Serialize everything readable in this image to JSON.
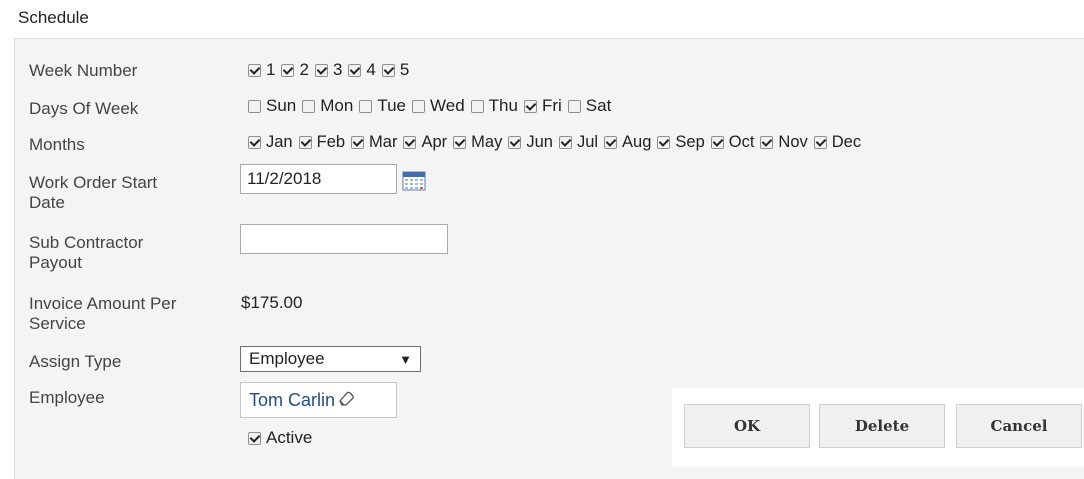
{
  "section_title": "Schedule",
  "labels": {
    "week_number": "Week Number",
    "days_of_week": "Days Of Week",
    "months": "Months",
    "work_order_start_date_1": "Work Order Start",
    "work_order_start_date_2": "Date",
    "sub_contractor_payout_1": "Sub Contractor",
    "sub_contractor_payout_2": "Payout",
    "invoice_amount_1": "Invoice Amount Per",
    "invoice_amount_2": "Service",
    "assign_type": "Assign Type",
    "employee": "Employee"
  },
  "week_numbers": [
    {
      "label": "1",
      "checked": true
    },
    {
      "label": "2",
      "checked": true
    },
    {
      "label": "3",
      "checked": true
    },
    {
      "label": "4",
      "checked": true
    },
    {
      "label": "5",
      "checked": true
    }
  ],
  "days": [
    {
      "label": "Sun",
      "checked": false
    },
    {
      "label": "Mon",
      "checked": false
    },
    {
      "label": "Tue",
      "checked": false
    },
    {
      "label": "Wed",
      "checked": false
    },
    {
      "label": "Thu",
      "checked": false
    },
    {
      "label": "Fri",
      "checked": true
    },
    {
      "label": "Sat",
      "checked": false
    }
  ],
  "months": [
    {
      "label": "Jan",
      "checked": true
    },
    {
      "label": "Feb",
      "checked": true
    },
    {
      "label": "Mar",
      "checked": true
    },
    {
      "label": "Apr",
      "checked": true
    },
    {
      "label": "May",
      "checked": true
    },
    {
      "label": "Jun",
      "checked": true
    },
    {
      "label": "Jul",
      "checked": true
    },
    {
      "label": "Aug",
      "checked": true
    },
    {
      "label": "Sep",
      "checked": true
    },
    {
      "label": "Oct",
      "checked": true
    },
    {
      "label": "Nov",
      "checked": true
    },
    {
      "label": "Dec",
      "checked": true
    }
  ],
  "fields": {
    "work_order_start_date": "11/2/2018",
    "sub_contractor_payout": "",
    "invoice_amount": "$175.00",
    "assign_type": "Employee",
    "employee_name": "Tom Carlin",
    "active_label": "Active",
    "active_checked": true
  },
  "icons": {
    "calendar": "calendar-icon",
    "eraser": "eraser-icon",
    "dropdown": "chevron-down-icon"
  },
  "buttons": {
    "ok": "OK",
    "delete": "Delete",
    "cancel": "Cancel"
  }
}
